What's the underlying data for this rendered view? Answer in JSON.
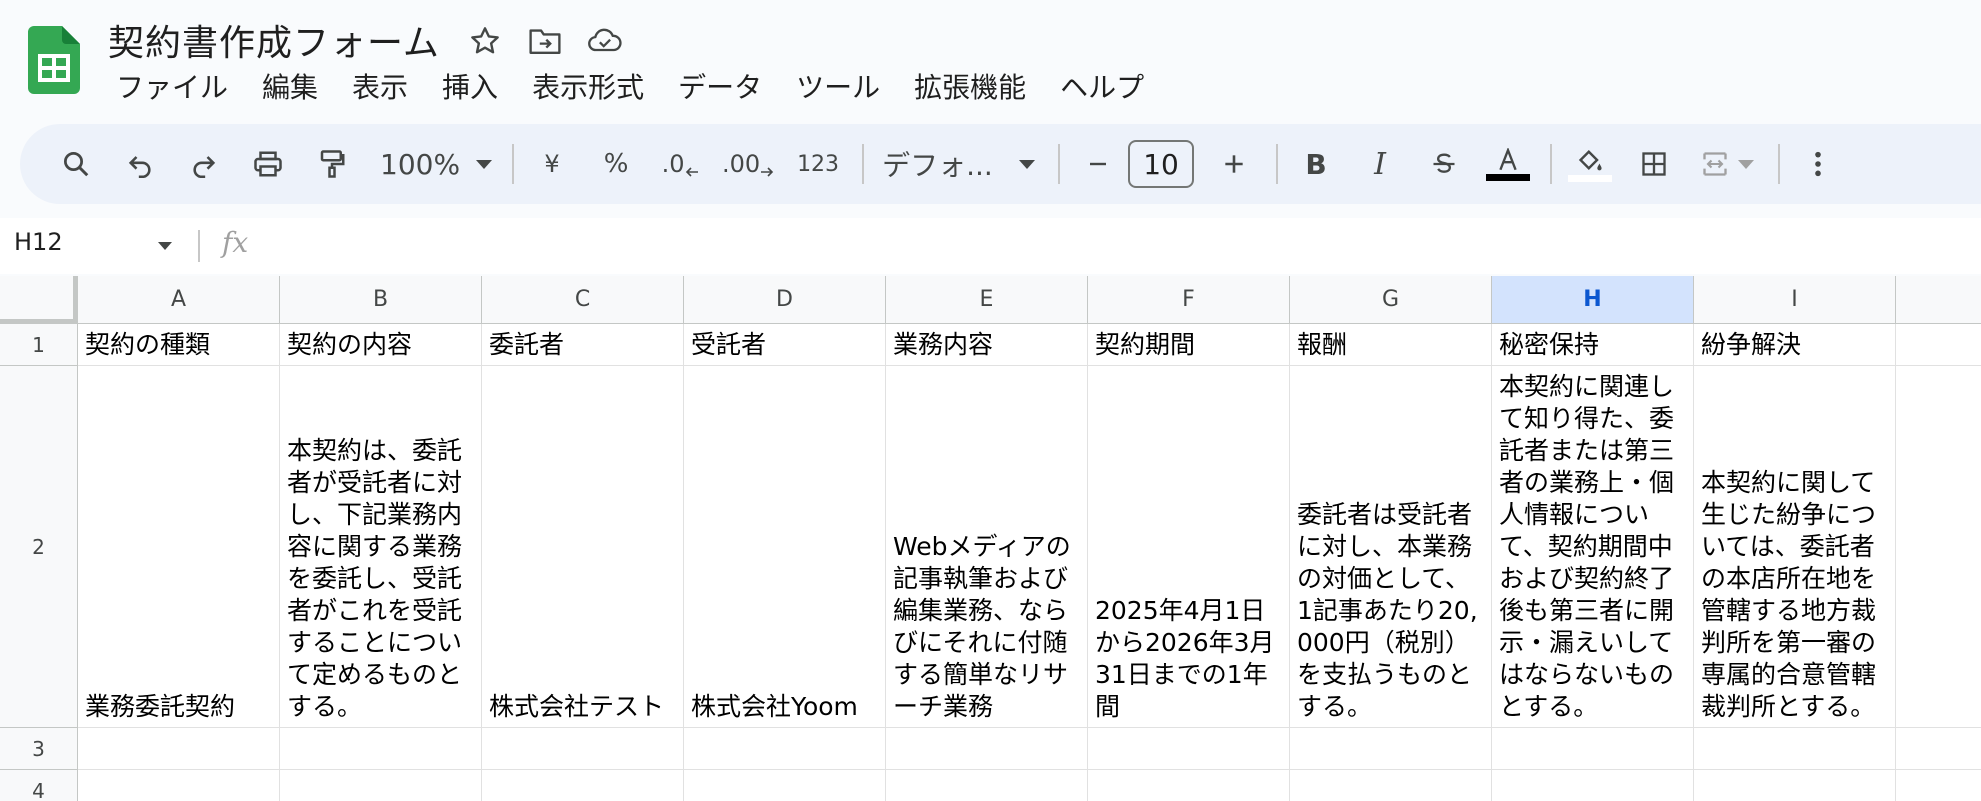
{
  "app": {
    "title": "契約書作成フォーム",
    "brand_color": "#34a853"
  },
  "menu": [
    "ファイル",
    "編集",
    "表示",
    "挿入",
    "表示形式",
    "データ",
    "ツール",
    "拡張機能",
    "ヘルプ"
  ],
  "toolbar": {
    "zoom": "100%",
    "currency": "¥",
    "percent": "%",
    "decrease_decimal": ".0",
    "increase_decimal": ".00",
    "number_format": "123",
    "font": "デフォ...",
    "font_size": "10",
    "text_color": "#000000"
  },
  "formula_bar": {
    "name_box": "H12",
    "fx": "fx"
  },
  "grid": {
    "columns": [
      "A",
      "B",
      "C",
      "D",
      "E",
      "F",
      "G",
      "H",
      "I"
    ],
    "selected_column": "H",
    "rows": [
      "1",
      "2",
      "3",
      "4"
    ],
    "header_row": [
      "契約の種類",
      "契約の内容",
      "委託者",
      "受託者",
      "業務内容",
      "契約期間",
      "報酬",
      "秘密保持",
      "紛争解決"
    ],
    "data_row": [
      "業務委託契約",
      "本契約は、委託者が受託者に対し、下記業務内容に関する業務を委託し、受託者がこれを受託することについて定めるものとする。",
      "株式会社テスト",
      "株式会社Yoom",
      "Webメディアの記事執筆および編集業務、ならびにそれに付随する簡単なリサーチ業務",
      "2025年4月1日から2026年3月31日までの1年間",
      "委託者は受託者に対し、本業務の対価として、1記事あたり20,000円（税別）を支払うものとする。",
      "本契約に関連して知り得た、委託者または第三者の業務上・個人情報について、契約期間中および契約終了後も第三者に開示・漏えいしてはならないものとする。",
      "本契約に関して生じた紛争については、委託者の本店所在地を管轄する地方裁判所を第一審の専属的合意管轄裁判所とする。"
    ]
  }
}
